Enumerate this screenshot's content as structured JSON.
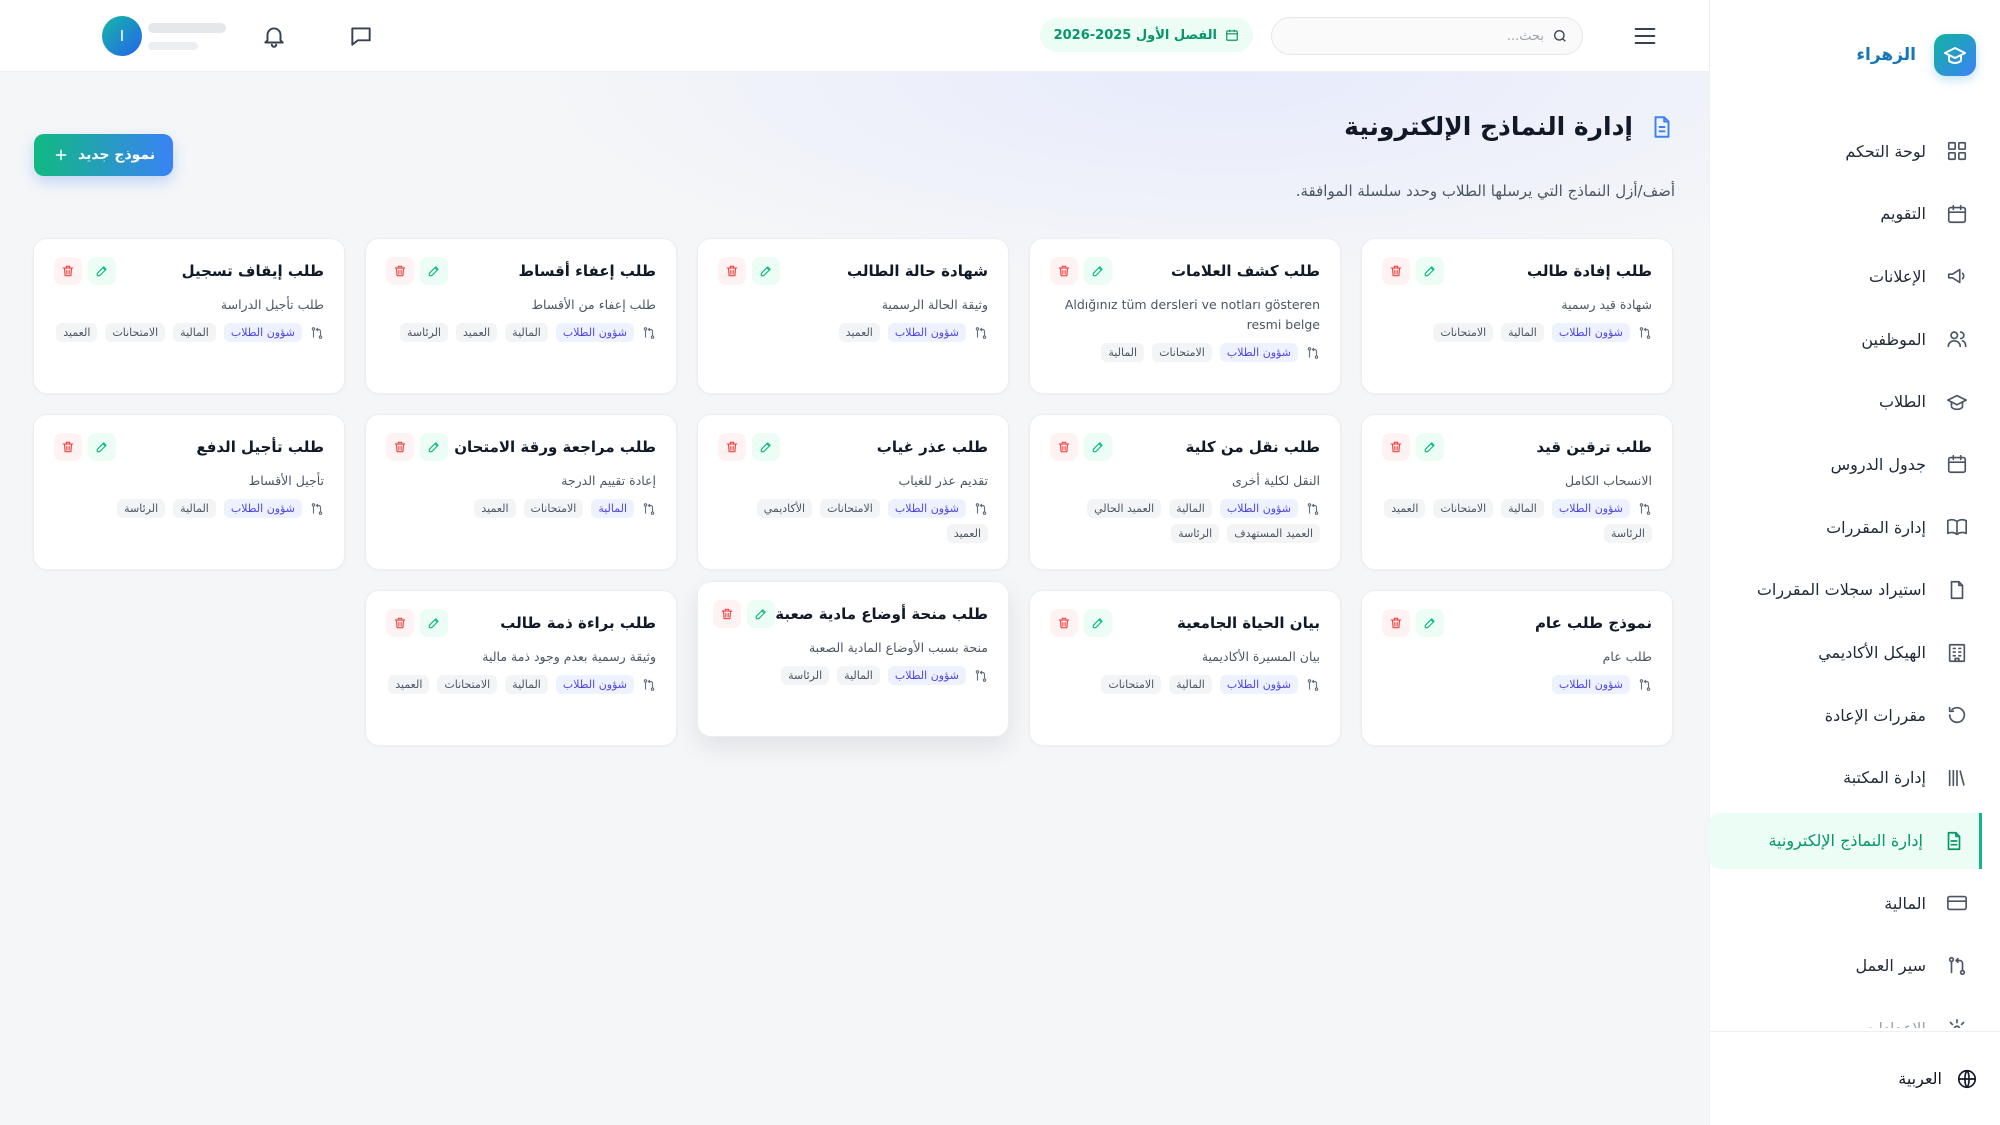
{
  "brand": {
    "name": "الزهراء"
  },
  "sidebar": {
    "items": [
      {
        "label": "لوحة التحكم",
        "icon": "dashboard-icon"
      },
      {
        "label": "التقويم",
        "icon": "calendar-icon"
      },
      {
        "label": "الإعلانات",
        "icon": "megaphone-icon"
      },
      {
        "label": "الموظفين",
        "icon": "users-icon"
      },
      {
        "label": "الطلاب",
        "icon": "graduation-cap-icon"
      },
      {
        "label": "جدول الدروس",
        "icon": "calendar-icon"
      },
      {
        "label": "إدارة المقررات",
        "icon": "book-icon"
      },
      {
        "label": "استيراد سجلات المقررات",
        "icon": "file-icon"
      },
      {
        "label": "الهيكل الأكاديمي",
        "icon": "building-icon"
      },
      {
        "label": "مقررات الإعادة",
        "icon": "rotate-icon"
      },
      {
        "label": "إدارة المكتبة",
        "icon": "library-icon"
      },
      {
        "label": "إدارة النماذج الإلكترونية",
        "icon": "file-text-icon",
        "active": true
      },
      {
        "label": "المالية",
        "icon": "credit-card-icon"
      },
      {
        "label": "سير العمل",
        "icon": "workflow-icon"
      },
      {
        "label": "الإعدادات",
        "icon": "gear-icon"
      }
    ],
    "language": "العربية"
  },
  "header": {
    "search_placeholder": "بحث...",
    "semester": "الفصل الأول 2025-2026",
    "avatar_initial": "I"
  },
  "page": {
    "title": "إدارة النماذج الإلكترونية",
    "description": "أضف/أزل النماذج التي يرسلها الطلاب وحدد سلسلة الموافقة.",
    "new_button": "نموذج جديد"
  },
  "forms": [
    {
      "title": "طلب إفادة طالب",
      "desc": "شهادة قيد رسمية",
      "tags": [
        "شؤون الطلاب",
        "المالية",
        "الامتحانات"
      ]
    },
    {
      "title": "طلب كشف العلامات",
      "desc": "Aldığınız tüm dersleri ve notları gösteren resmi belge",
      "tags": [
        "شؤون الطلاب",
        "الامتحانات",
        "المالية"
      ]
    },
    {
      "title": "شهادة حالة الطالب",
      "desc": "وثيقة الحالة الرسمية",
      "tags": [
        "شؤون الطلاب",
        "العميد"
      ]
    },
    {
      "title": "طلب إعفاء أقساط",
      "desc": "طلب إعفاء من الأقساط",
      "tags": [
        "شؤون الطلاب",
        "المالية",
        "العميد",
        "الرئاسة"
      ]
    },
    {
      "title": "طلب إيقاف تسجيل",
      "desc": "طلب تأجيل الدراسة",
      "tags": [
        "شؤون الطلاب",
        "المالية",
        "الامتحانات",
        "العميد"
      ]
    },
    {
      "title": "طلب ترقين قيد",
      "desc": "الانسحاب الكامل",
      "tags": [
        "شؤون الطلاب",
        "المالية",
        "الامتحانات",
        "العميد",
        "الرئاسة"
      ]
    },
    {
      "title": "طلب نقل من كلية",
      "desc": "النقل لكلية أخرى",
      "tags": [
        "شؤون الطلاب",
        "المالية",
        "العميد الحالي",
        "العميد المستهدف",
        "الرئاسة"
      ]
    },
    {
      "title": "طلب عذر غياب",
      "desc": "تقديم عذر للغياب",
      "tags": [
        "شؤون الطلاب",
        "الامتحانات",
        "الأكاديمي",
        "العميد"
      ]
    },
    {
      "title": "طلب مراجعة ورقة الامتحان",
      "desc": "إعادة تقييم الدرجة",
      "tags": [
        "المالية",
        "الامتحانات",
        "العميد"
      ]
    },
    {
      "title": "طلب تأجيل الدفع",
      "desc": "تأجيل الأقساط",
      "tags": [
        "شؤون الطلاب",
        "المالية",
        "الرئاسة"
      ]
    },
    {
      "title": "نموذج طلب عام",
      "desc": "طلب عام",
      "tags": [
        "شؤون الطلاب"
      ]
    },
    {
      "title": "بيان الحياة الجامعية",
      "desc": "بيان المسيرة الأكاديمية",
      "tags": [
        "شؤون الطلاب",
        "المالية",
        "الامتحانات"
      ]
    },
    {
      "title": "طلب منحة أوضاع مادية صعبة",
      "desc": "منحة بسبب الأوضاع المادية الصعبة",
      "tags": [
        "شؤون الطلاب",
        "المالية",
        "الرئاسة"
      ],
      "raised": true
    },
    {
      "title": "طلب براءة ذمة طالب",
      "desc": "وثيقة رسمية بعدم وجود ذمة مالية",
      "tags": [
        "شؤون الطلاب",
        "المالية",
        "الامتحانات",
        "العميد"
      ]
    }
  ],
  "colors": {
    "accent": "#10b981",
    "brand": "#1676b8",
    "danger": "#ef4444",
    "primary_button": "#3b82f6"
  }
}
